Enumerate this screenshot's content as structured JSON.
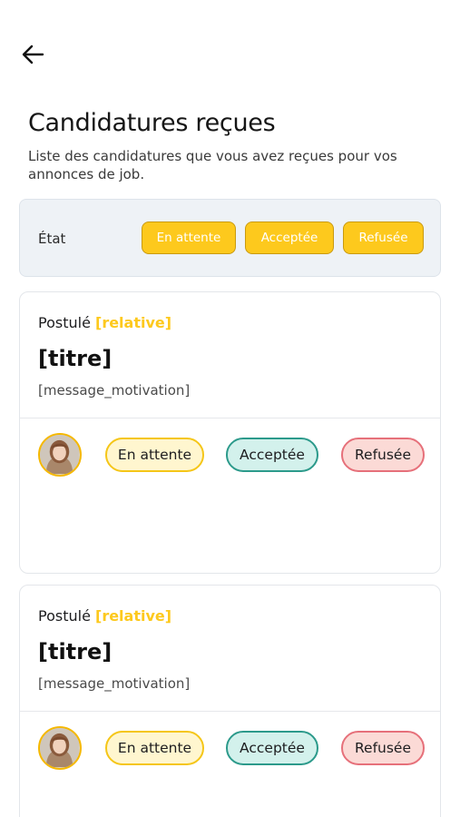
{
  "header": {
    "back_icon": "arrow-left-icon"
  },
  "page": {
    "title": "Candidatures reçues",
    "subtitle": "Liste des candidatures que vous avez reçues pour vos annonces de job."
  },
  "filter": {
    "label": "État",
    "chips": [
      {
        "label": "En attente"
      },
      {
        "label": "Acceptée"
      },
      {
        "label": "Refusée"
      }
    ],
    "chip_color": "#fdc91d"
  },
  "applications": [
    {
      "postule_label": "Postulé",
      "relative": "[relative]",
      "title": "[titre]",
      "message": "[message_motivation]",
      "avatar_icon": "user-avatar",
      "statuses": {
        "pending": "En attente",
        "accepted": "Acceptée",
        "refused": "Refusée"
      }
    },
    {
      "postule_label": "Postulé",
      "relative": "[relative]",
      "title": "[titre]",
      "message": "[message_motivation]",
      "avatar_icon": "user-avatar",
      "statuses": {
        "pending": "En attente",
        "accepted": "Acceptée",
        "refused": "Refusée"
      }
    }
  ],
  "colors": {
    "accent_yellow": "#fdc91d",
    "pending_bg": "#fff6cf",
    "accepted_border": "#2c9a8b",
    "accepted_bg": "#d3f1ec",
    "refused_border": "#e6707a",
    "refused_bg": "#fbdad6"
  }
}
